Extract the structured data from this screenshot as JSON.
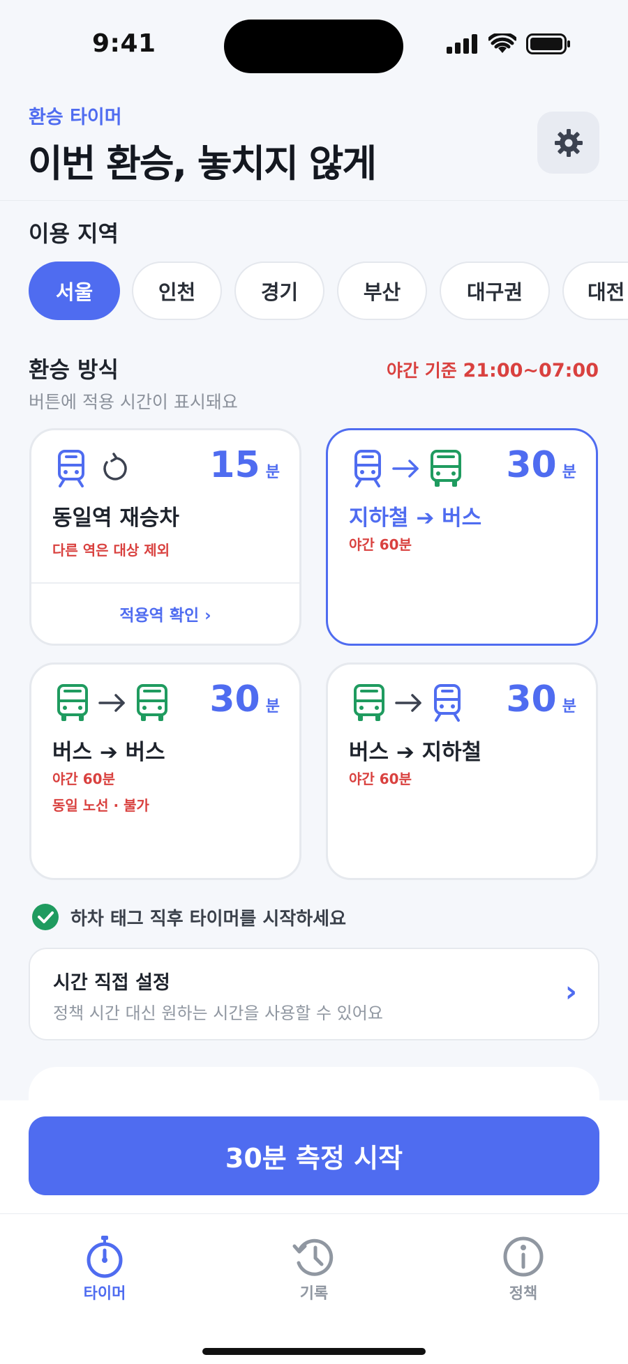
{
  "status": {
    "time": "9:41"
  },
  "header": {
    "subtitle": "환승 타이머",
    "title": "이번 환승, 놓치지 않게"
  },
  "region": {
    "label": "이용 지역",
    "chips": [
      "서울",
      "인천",
      "경기",
      "부산",
      "대구권",
      "대전"
    ],
    "selected": "서울"
  },
  "transfer": {
    "label": "환승 방식",
    "hint": "버튼에 적용 시간이 표시돼요",
    "night_prefix": "야간 기준",
    "night_hours": "21:00~07:00",
    "unit": "분",
    "cards": [
      {
        "name": "동일역 재승차",
        "minutes": "15",
        "note1": "다른 역은 대상 제외",
        "link": "적용역 확인 ›"
      },
      {
        "name": "지하철 ➔ 버스",
        "minutes": "30",
        "note1": "야간 60분"
      },
      {
        "name": "버스 ➔ 버스",
        "minutes": "30",
        "note1": "야간 60분",
        "note2": "동일 노선 · 불가"
      },
      {
        "name": "버스 ➔ 지하철",
        "minutes": "30",
        "note1": "야간 60분"
      }
    ]
  },
  "tip": "하차 태그 직후 타이머를 시작하세요",
  "custom": {
    "title": "시간 직접 설정",
    "subtitle": "정책 시간 대신 원하는 시간을 사용할 수 있어요",
    "arrow": "›"
  },
  "start_button": "30분 측정 시작",
  "tabs": [
    {
      "label": "타이머",
      "icon": "stopwatch-icon"
    },
    {
      "label": "기록",
      "icon": "history-icon"
    },
    {
      "label": "정책",
      "icon": "info-icon"
    }
  ],
  "colors": {
    "accent": "#4f6cf0",
    "night": "#d9413f",
    "bus": "#1f9b5f"
  }
}
